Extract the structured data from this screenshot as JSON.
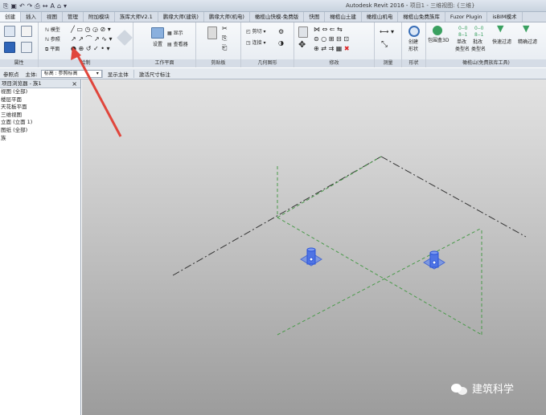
{
  "titlebar": {
    "app_title": "Autodesk Revit 2016 -",
    "doc_title": "项目1 - 三维视图: {三维}"
  },
  "tabs": [
    "创建",
    "插入",
    "视图",
    "管理",
    "附加模块",
    "族库大师V2.1",
    "鹏缘大师(建筑)",
    "鹏缘大师(机电)",
    "橄榄山快模-免费版",
    "快图",
    "橄榄山土建",
    "橄榄山机电",
    "橄榄山免费族库",
    "Fuzor Plugin",
    "isBIM模术"
  ],
  "ribbon": {
    "panels": {
      "properties": "属性",
      "draw": "绘制",
      "workplane": "工作平面",
      "clipboard": "剪贴板",
      "geometry": "几何图形",
      "modify": "修改",
      "measure": "测量",
      "form": "形状",
      "olive_tools": "橄榄山(免费族库工具)"
    },
    "buttons": {
      "model_line": "模型",
      "ref_plane": "参照",
      "plane": "平面",
      "set": "设置",
      "show": "显示",
      "viewer": "查看器",
      "cut": "剪切",
      "join": "连接",
      "create_form": "创建",
      "form_sub": "形状",
      "bbox3d": "包围盒3D",
      "single_change": "单改",
      "batch_change": "批改",
      "quick_filter": "快速过滤",
      "precise_filter": "精确过滤",
      "type_name1": "类型名",
      "type_name2": "类型名"
    }
  },
  "options_bar": {
    "label": "参照点",
    "host_label": "主体:",
    "host_value": "标高 : 参照标高",
    "show_host": "显示主体",
    "temp_dim": "激活尺寸标注"
  },
  "browser": {
    "title": "项目浏览器 - 族1",
    "items": [
      "视图 (全部)",
      "楼层平面",
      "天花板平面",
      "三维视图",
      "立面 (立面 1)",
      "图纸 (全部)",
      "族"
    ]
  },
  "watermark": {
    "text": "建筑科学"
  },
  "colors": {
    "arrow": "#e0463c",
    "point": "#2b55d8",
    "dashed_green": "#4a9a4a"
  }
}
